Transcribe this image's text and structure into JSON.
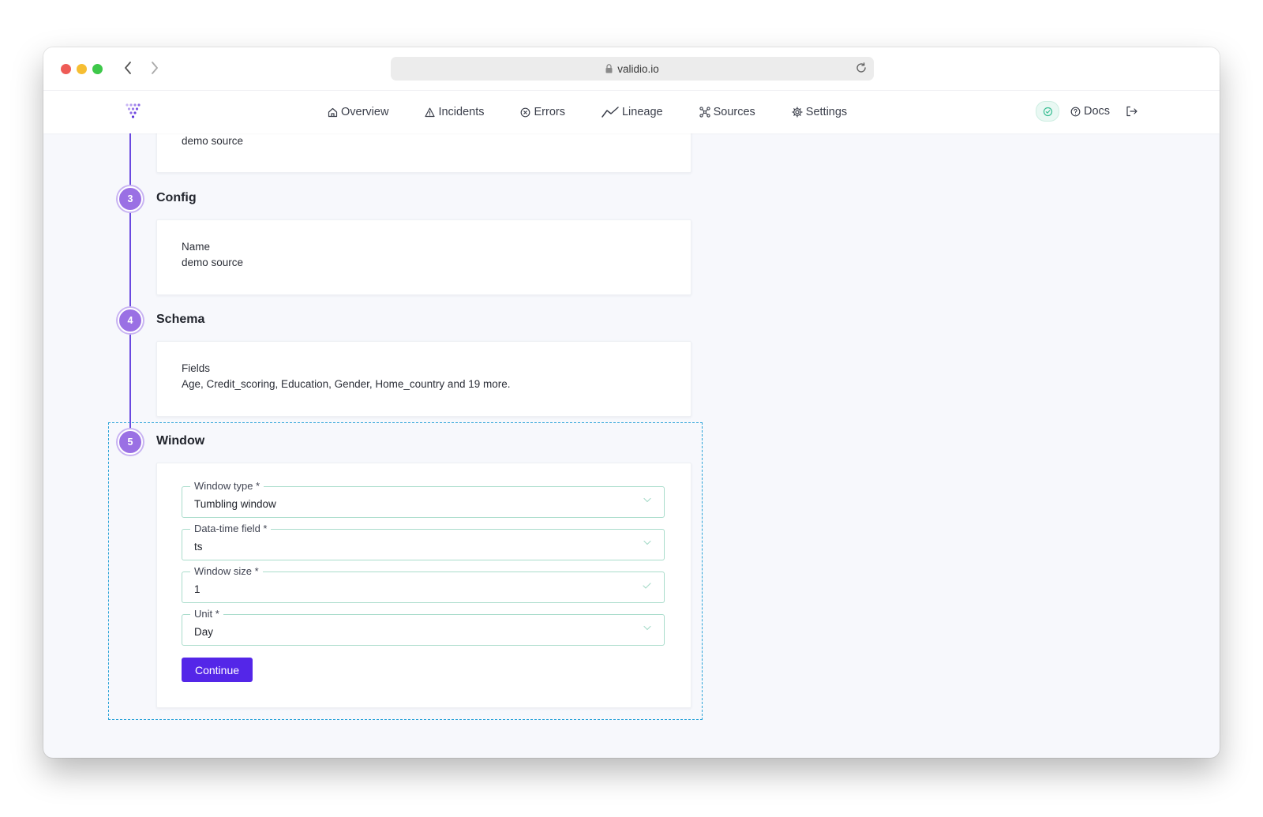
{
  "browser": {
    "url": "validio.io"
  },
  "nav": {
    "items": [
      {
        "label": "Overview",
        "icon": "home-icon"
      },
      {
        "label": "Incidents",
        "icon": "warning-triangle-icon"
      },
      {
        "label": "Errors",
        "icon": "x-circle-icon"
      },
      {
        "label": "Lineage",
        "icon": "trend-line-icon"
      },
      {
        "label": "Sources",
        "icon": "network-nodes-icon"
      },
      {
        "label": "Settings",
        "icon": "gear-icon"
      }
    ],
    "docs_label": "Docs"
  },
  "steps": {
    "source": {
      "value": "demo source"
    },
    "config": {
      "number": "3",
      "title": "Config",
      "name_label": "Name",
      "name_value": "demo source"
    },
    "schema": {
      "number": "4",
      "title": "Schema",
      "fields_label": "Fields",
      "fields_value": "Age, Credit_scoring, Education, Gender, Home_country and 19 more."
    },
    "window": {
      "number": "5",
      "title": "Window",
      "fields": [
        {
          "label": "Window type *",
          "value": "Tumbling window",
          "icon": "chevron-down-icon"
        },
        {
          "label": "Data-time field *",
          "value": "ts",
          "icon": "chevron-down-icon"
        },
        {
          "label": "Window size *",
          "value": "1",
          "icon": "check-icon"
        },
        {
          "label": "Unit *",
          "value": "Day",
          "icon": "chevron-down-icon"
        }
      ],
      "continue_label": "Continue"
    }
  },
  "colors": {
    "accent": "#5426e8",
    "timeline": "#6a49e0",
    "step_circle": "#9a70e4",
    "field_border": "#a9dccb",
    "focus_outline": "#2aa3d8"
  }
}
